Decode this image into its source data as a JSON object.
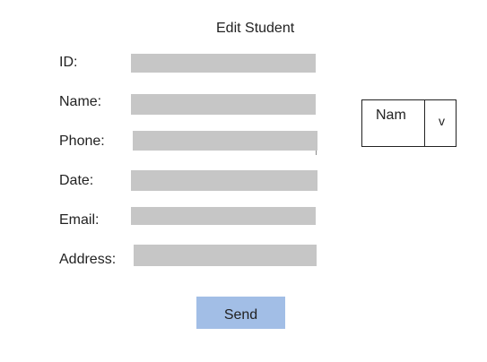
{
  "form": {
    "title": "Edit Student",
    "fields": [
      {
        "label": "ID:",
        "value": ""
      },
      {
        "label": "Name:",
        "value": ""
      },
      {
        "label": "Phone:",
        "value": ""
      },
      {
        "label": "Date:",
        "value": ""
      },
      {
        "label": "Email:",
        "value": ""
      },
      {
        "label": "Address:",
        "value": ""
      }
    ],
    "send_label": "Send"
  },
  "sort_select": {
    "selected": "Nam",
    "arrow": "v"
  },
  "colors": {
    "field_background": "#c6c6c6",
    "button_background": "#a2bee6",
    "text": "#222222"
  }
}
